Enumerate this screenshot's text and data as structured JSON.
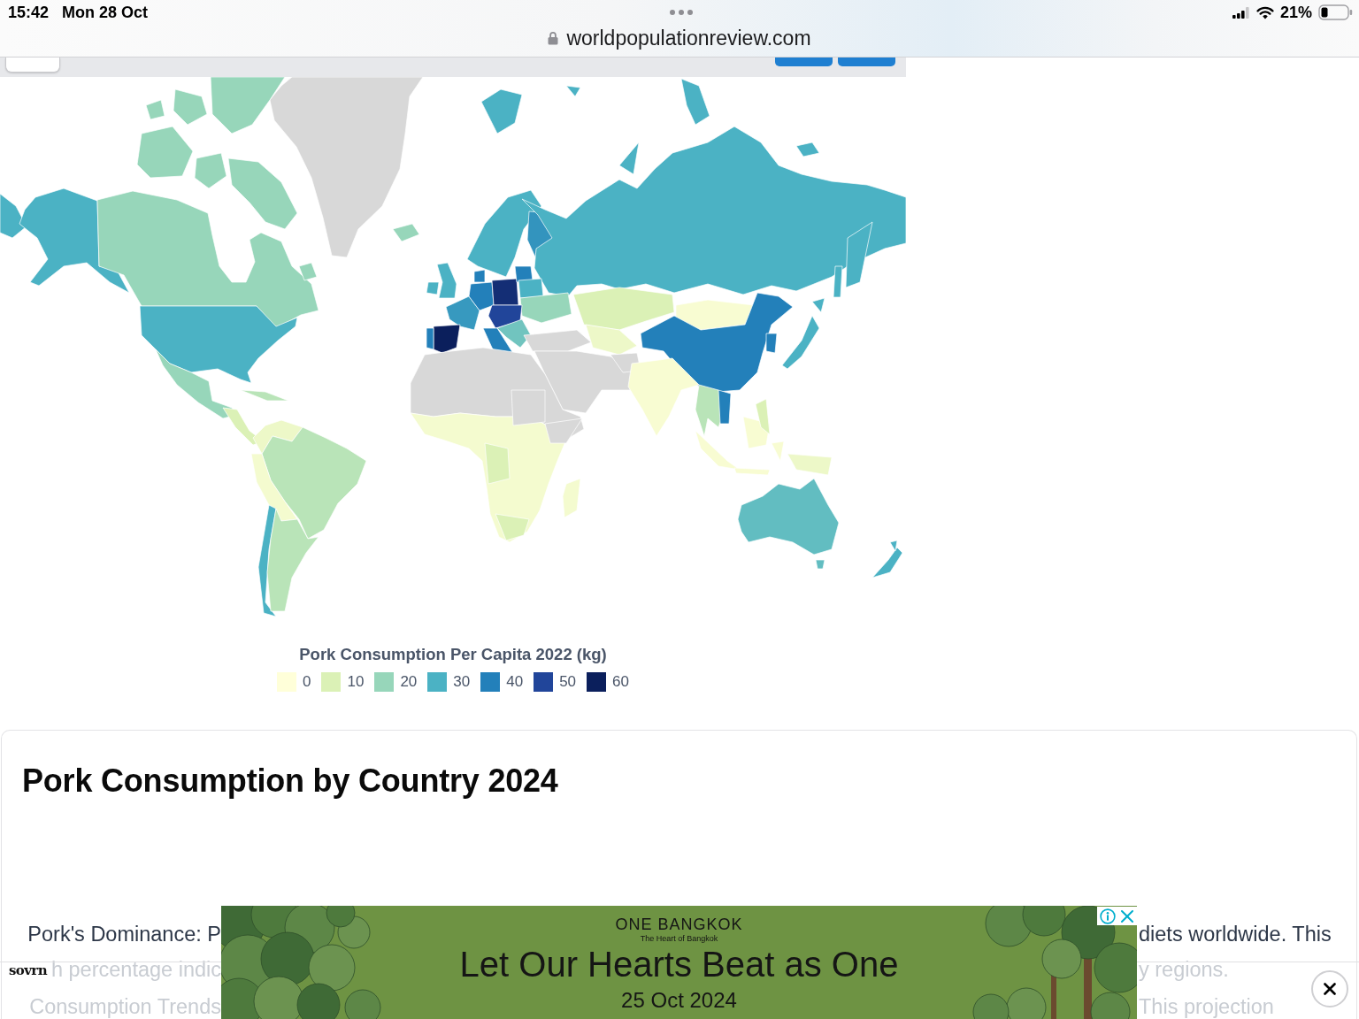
{
  "status_bar": {
    "time": "15:42",
    "date": "Mon 28 Oct",
    "battery": "21%"
  },
  "address_bar": {
    "url": "worldpopulationreview.com"
  },
  "map": {
    "legend": {
      "title": "Pork Consumption Per Capita 2022 (kg)",
      "items": [
        {
          "label": "0",
          "color": "#ffffd9"
        },
        {
          "label": "10",
          "color": "#dbf1b6"
        },
        {
          "label": "20",
          "color": "#97d6ba"
        },
        {
          "label": "30",
          "color": "#4bb2c4"
        },
        {
          "label": "40",
          "color": "#2380ba"
        },
        {
          "label": "50",
          "color": "#21459a"
        },
        {
          "label": "60",
          "color": "#0b1f5c"
        }
      ]
    }
  },
  "article": {
    "heading": "Pork Consumption by Country 2024",
    "paragraphs": [
      {
        "lines": [
          {
            "left": "Pork's Dominance: P",
            "right": "diets worldwide. This"
          },
          {
            "left": "h percentage indic",
            "right": "y regions."
          }
        ]
      },
      {
        "lines": [
          {
            "left": "Consumption Trends",
            "right": "This projection"
          }
        ]
      }
    ]
  },
  "ad": {
    "brand": "ONE BANGKOK",
    "tagline": "The Heart of Bangkok",
    "headline": "Let Our Hearts Beat as One",
    "date": "25 Oct 2024"
  },
  "ad_bar": {
    "logo": "sovrn"
  }
}
